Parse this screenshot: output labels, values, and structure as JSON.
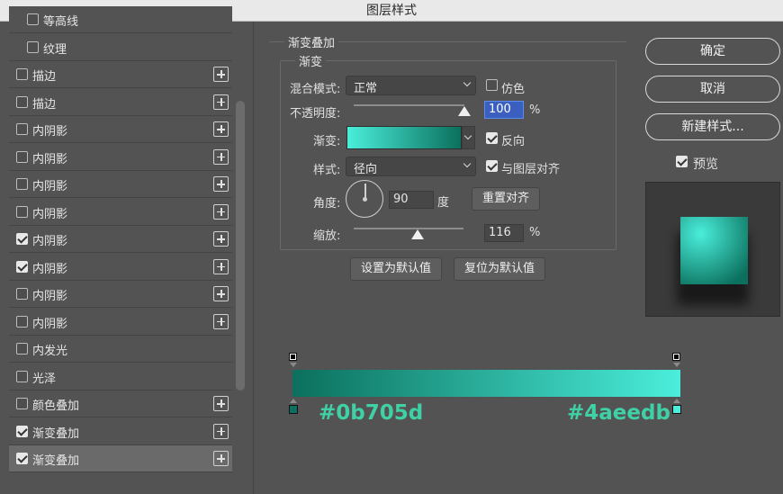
{
  "window": {
    "title": "图层样式"
  },
  "sidebar": {
    "items": [
      {
        "label": "等高线",
        "checked": false,
        "indent": true,
        "plus": false,
        "partial": true
      },
      {
        "label": "纹理",
        "checked": false,
        "indent": true,
        "plus": false
      },
      {
        "label": "描边",
        "checked": false,
        "indent": false,
        "plus": true
      },
      {
        "label": "描边",
        "checked": false,
        "indent": false,
        "plus": true
      },
      {
        "label": "内阴影",
        "checked": false,
        "indent": false,
        "plus": true
      },
      {
        "label": "内阴影",
        "checked": false,
        "indent": false,
        "plus": true
      },
      {
        "label": "内阴影",
        "checked": false,
        "indent": false,
        "plus": true
      },
      {
        "label": "内阴影",
        "checked": false,
        "indent": false,
        "plus": true
      },
      {
        "label": "内阴影",
        "checked": true,
        "indent": false,
        "plus": true
      },
      {
        "label": "内阴影",
        "checked": true,
        "indent": false,
        "plus": true
      },
      {
        "label": "内阴影",
        "checked": false,
        "indent": false,
        "plus": true
      },
      {
        "label": "内阴影",
        "checked": false,
        "indent": false,
        "plus": true
      },
      {
        "label": "内发光",
        "checked": false,
        "indent": false,
        "plus": false
      },
      {
        "label": "光泽",
        "checked": false,
        "indent": false,
        "plus": false
      },
      {
        "label": "颜色叠加",
        "checked": false,
        "indent": false,
        "plus": true
      },
      {
        "label": "渐变叠加",
        "checked": true,
        "indent": false,
        "plus": true
      },
      {
        "label": "渐变叠加",
        "checked": true,
        "indent": false,
        "plus": true,
        "selected": true
      }
    ]
  },
  "panel": {
    "title": "渐变叠加",
    "group_title": "渐变",
    "blend_mode_label": "混合模式:",
    "blend_mode_value": "正常",
    "dither_label": "仿色",
    "dither_checked": false,
    "opacity_label": "不透明度:",
    "opacity_value": "100",
    "opacity_unit": "%",
    "opacity_level": 1.0,
    "gradient_label": "渐变:",
    "reverse_label": "反向",
    "reverse_checked": true,
    "style_label": "样式:",
    "style_value": "径向",
    "align_label": "与图层对齐",
    "align_checked": true,
    "angle_label": "角度:",
    "angle_value": "90",
    "angle_unit": "度",
    "reset_align_label": "重置对齐",
    "scale_label": "缩放:",
    "scale_value": "116",
    "scale_unit": "%",
    "scale_level": 0.58,
    "set_default_label": "设置为默认值",
    "reset_default_label": "复位为默认值"
  },
  "actions": {
    "ok_label": "确定",
    "cancel_label": "取消",
    "new_style_label": "新建样式...",
    "preview_label": "预览",
    "preview_checked": true
  },
  "gradient": {
    "start_color": "#0b705d",
    "end_color": "#4aeedb",
    "start_label": "#0b705d",
    "end_label": "#4aeedb"
  }
}
